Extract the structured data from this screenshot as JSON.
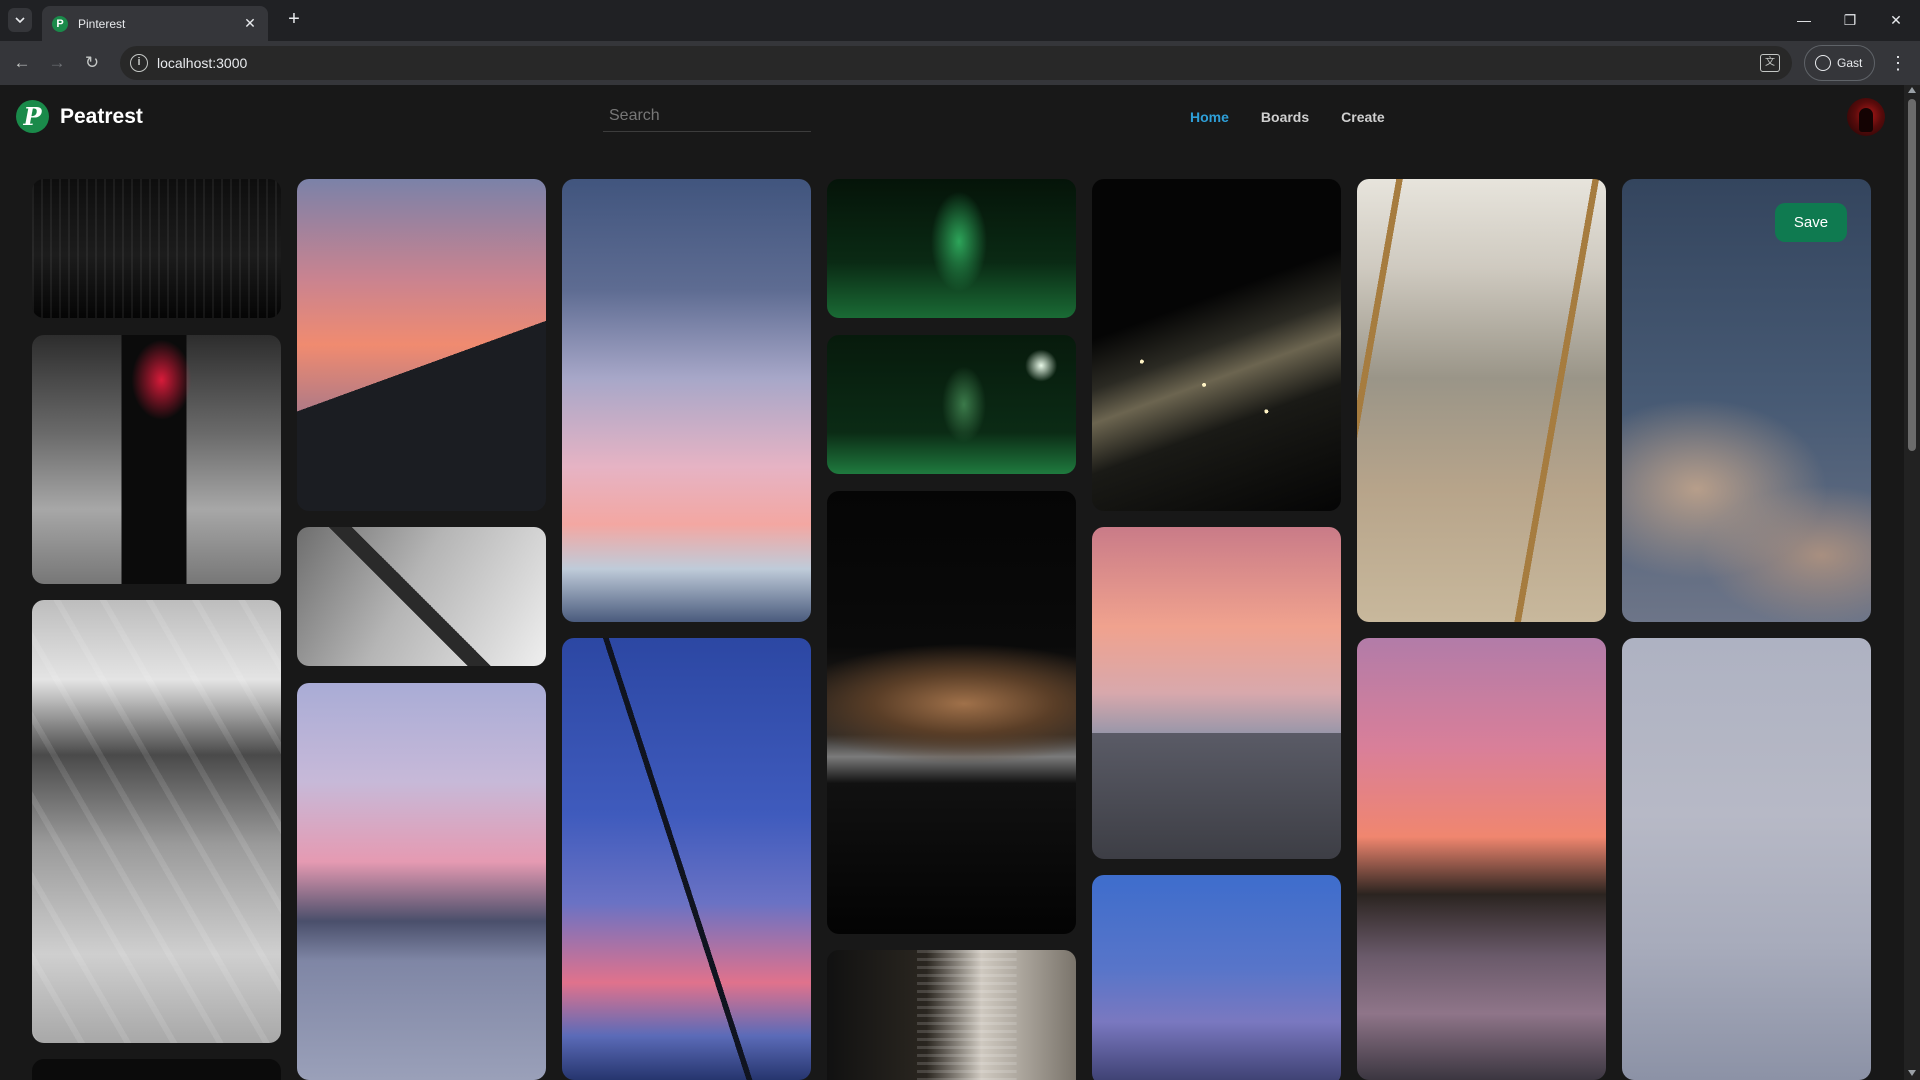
{
  "browser": {
    "tab_title": "Pinterest",
    "favicon_letter": "P",
    "url": "localhost:3000",
    "profile_label": "Gast",
    "icons": [
      "tab-search-icon",
      "close-icon",
      "plus-icon",
      "minimize-icon",
      "restore-icon",
      "close-window-icon",
      "back-arrow-icon",
      "forward-arrow-icon",
      "reload-icon",
      "site-info-icon",
      "translate-icon",
      "profile-icon",
      "more-vertical-icon"
    ]
  },
  "header": {
    "logo_letter": "P",
    "brand": "Peatrest",
    "search_placeholder": "Search",
    "nav": [
      {
        "label": "Home",
        "active": true
      },
      {
        "label": "Boards",
        "active": false
      },
      {
        "label": "Create",
        "active": false
      }
    ]
  },
  "pins": [
    {
      "name": "pin-dark-stage-curtain"
    },
    {
      "name": "pin-dancer-red-light"
    },
    {
      "name": "pin-dance-studio-mirrors"
    },
    {
      "name": "pin-dark-image"
    },
    {
      "name": "pin-pink-sunset-rooftops"
    },
    {
      "name": "pin-white-room-sign"
    },
    {
      "name": "pin-river-graffiti-sunset"
    },
    {
      "name": "pin-blue-sky-clouds"
    },
    {
      "name": "pin-crane-sunset"
    },
    {
      "name": "pin-green-stage-performer"
    },
    {
      "name": "pin-green-stage-light"
    },
    {
      "name": "pin-cookies-baking-tray"
    },
    {
      "name": "pin-window-blinds"
    },
    {
      "name": "pin-city-lights-night"
    },
    {
      "name": "pin-sunset-houses"
    },
    {
      "name": "pin-evening-blue-sky"
    },
    {
      "name": "pin-art-studio-easels"
    },
    {
      "name": "pin-sunset-river-boat"
    },
    {
      "name": "pin-dusk-clouds"
    },
    {
      "name": "pin-pale-sky"
    }
  ],
  "save_button": {
    "label": "Save",
    "color": "#0f7a50"
  },
  "colors": {
    "accent": "#2e9fd8",
    "background": "#181818",
    "logo": "#1a8a4a"
  }
}
